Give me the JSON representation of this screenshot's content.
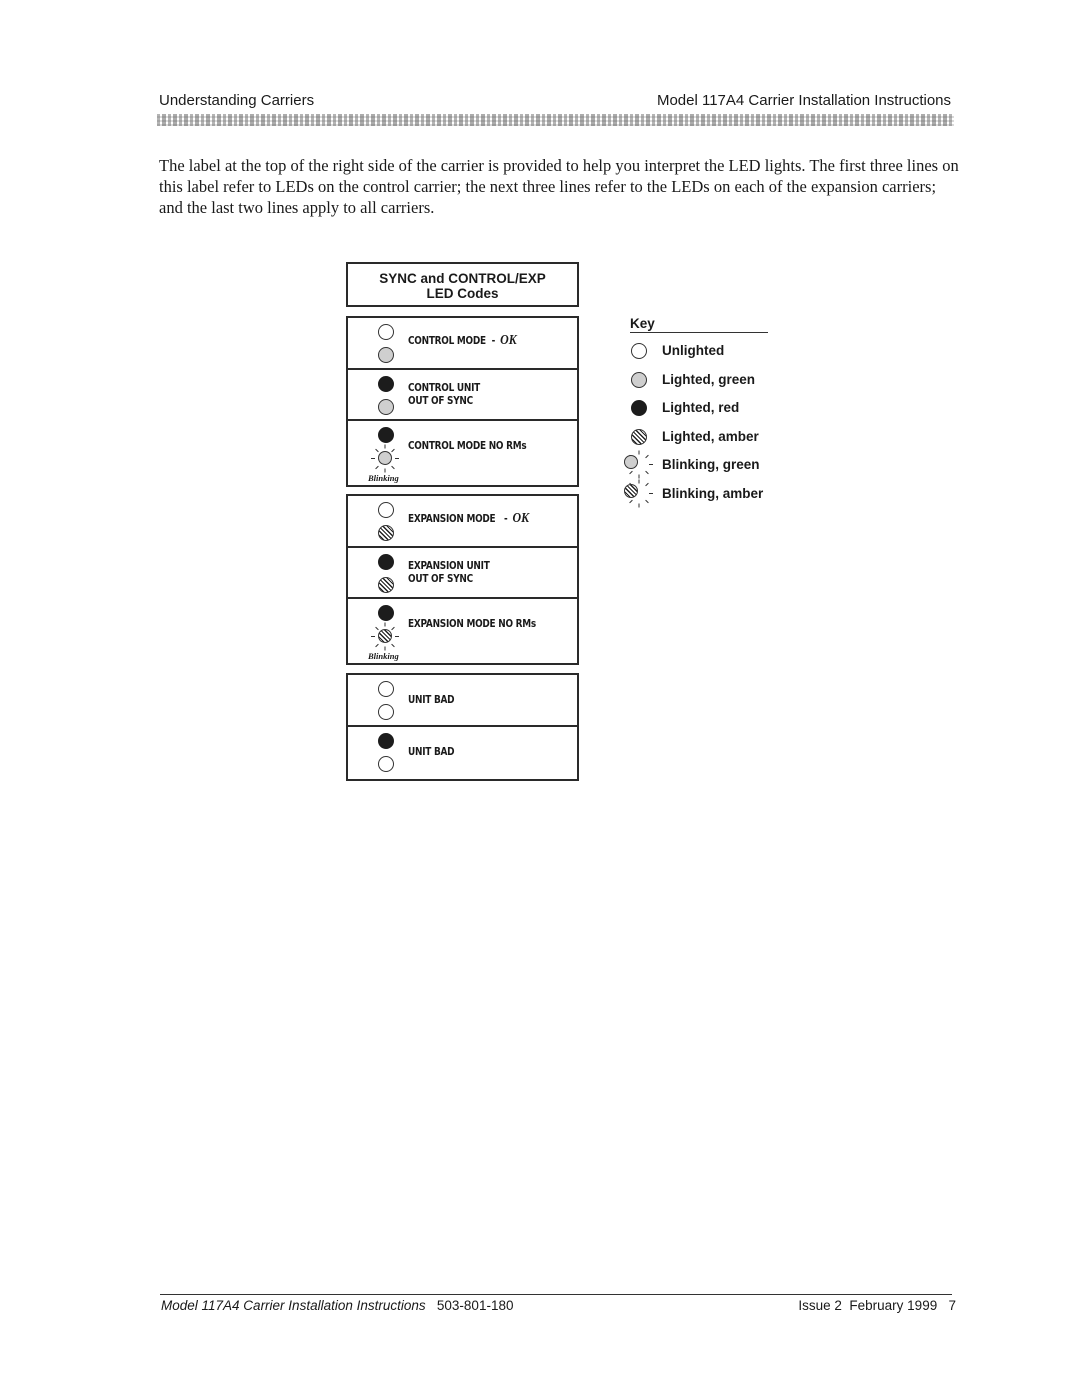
{
  "header": {
    "section": "Understanding Carriers",
    "document_title": "Model 117A4 Carrier Installation Instructions"
  },
  "body": {
    "paragraph": "The label at the top of the right side of the carrier is provided to help you interpret the LED lights. The first three lines on this label refer to LEDs on the control carrier; the next three lines refer to the LEDs on each of the expansion carriers; and the last two lines apply to all carriers."
  },
  "label": {
    "title_line1": "SYNC and CONTROL/EXP",
    "title_line2": "LED Codes",
    "blinking_caption": "Blinking",
    "ok_text": "OK",
    "groups": [
      {
        "name": "control",
        "rows": [
          {
            "top_led": "unlighted",
            "bottom_led": "lighted-green",
            "line1": "CONTROL MODE  -",
            "line2": "",
            "ok": true
          },
          {
            "top_led": "lighted-red",
            "bottom_led": "lighted-green",
            "line1": "CONTROL UNIT",
            "line2": "OUT OF SYNC",
            "ok": false
          },
          {
            "top_led": "lighted-red",
            "bottom_led": "blinking-green",
            "line1": "CONTROL MODE NO RMs",
            "line2": "",
            "ok": false
          }
        ]
      },
      {
        "name": "expansion",
        "rows": [
          {
            "top_led": "unlighted",
            "bottom_led": "lighted-amber",
            "line1": "EXPANSION MODE   -",
            "line2": "",
            "ok": true
          },
          {
            "top_led": "lighted-red",
            "bottom_led": "lighted-amber",
            "line1": "EXPANSION UNIT",
            "line2": "OUT OF SYNC",
            "ok": false
          },
          {
            "top_led": "lighted-red",
            "bottom_led": "blinking-amber",
            "line1": "EXPANSION MODE NO RMs",
            "line2": "",
            "ok": false
          }
        ]
      },
      {
        "name": "all",
        "rows": [
          {
            "top_led": "unlighted",
            "bottom_led": "unlighted",
            "line1": "UNIT BAD",
            "line2": "",
            "ok": false
          },
          {
            "top_led": "lighted-red",
            "bottom_led": "unlighted",
            "line1": "UNIT BAD",
            "line2": "",
            "ok": false
          }
        ]
      }
    ]
  },
  "key": {
    "title": "Key",
    "items": [
      {
        "icon": "unlighted",
        "label": "Unlighted"
      },
      {
        "icon": "lighted-green",
        "label": "Lighted, green"
      },
      {
        "icon": "lighted-red",
        "label": "Lighted, red"
      },
      {
        "icon": "lighted-amber",
        "label": "Lighted, amber"
      },
      {
        "icon": "blinking-green",
        "label": "Blinking, green"
      },
      {
        "icon": "blinking-amber",
        "label": "Blinking, amber"
      }
    ]
  },
  "footer": {
    "doc_title": "Model 117A4 Carrier Installation Instructions",
    "doc_number": "503-801-180",
    "issue": "Issue 2  February 1999",
    "page_number": "7"
  },
  "colors": {
    "led_green": "#cfcfcf",
    "led_red": "#1c1c1c",
    "border": "#2a2a2a"
  }
}
